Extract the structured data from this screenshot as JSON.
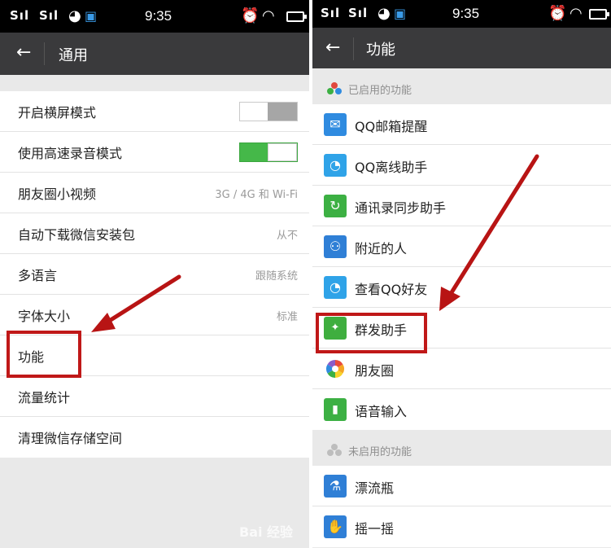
{
  "left": {
    "status": {
      "signal1": "Sıl",
      "signal2": "Sıl",
      "time": "9:35"
    },
    "title": "通用",
    "rows": [
      {
        "label": "开启横屏模式",
        "type": "toggle",
        "state": "off"
      },
      {
        "label": "使用高速录音模式",
        "type": "toggle",
        "state": "on"
      },
      {
        "label": "朋友圈小视频",
        "type": "value",
        "value": "3G / 4G 和 Wi-Fi"
      },
      {
        "label": "自动下载微信安装包",
        "type": "value",
        "value": "从不"
      },
      {
        "label": "多语言",
        "type": "value",
        "value": "跟随系统"
      },
      {
        "label": "字体大小",
        "type": "value",
        "value": "标准"
      },
      {
        "label": "功能",
        "type": "plain"
      },
      {
        "label": "流量统计",
        "type": "plain"
      },
      {
        "label": "清理微信存储空间",
        "type": "plain"
      }
    ],
    "watermark": "Bai 经验"
  },
  "right": {
    "status": {
      "signal1": "Sıl",
      "signal2": "Sıl",
      "time": "9:35"
    },
    "title": "功能",
    "enabled_header": "已启用的功能",
    "enabled": [
      {
        "label": "QQ邮箱提醒",
        "icon": "mail-icon",
        "color": "#2f8be0",
        "glyph": "✉"
      },
      {
        "label": "QQ离线助手",
        "icon": "qq-penguin-icon",
        "color": "#2fa3e8",
        "glyph": "◔"
      },
      {
        "label": "通讯录同步助手",
        "icon": "contact-sync-icon",
        "color": "#3cb043",
        "glyph": "↻"
      },
      {
        "label": "附近的人",
        "icon": "people-nearby-icon",
        "color": "#2f7fd6",
        "glyph": "⚇"
      },
      {
        "label": "查看QQ好友",
        "icon": "qq-friends-icon",
        "color": "#2fa3e8",
        "glyph": "◔"
      },
      {
        "label": "群发助手",
        "icon": "broadcast-icon",
        "color": "#3fae3f",
        "glyph": "✦"
      },
      {
        "label": "朋友圈",
        "icon": "moments-icon",
        "color": "#ffffff",
        "glyph": ""
      },
      {
        "label": "语音输入",
        "icon": "microphone-icon",
        "color": "#3cb043",
        "glyph": "🎙"
      }
    ],
    "disabled_header": "未启用的功能",
    "disabled": [
      {
        "label": "漂流瓶",
        "icon": "drift-bottle-icon",
        "color": "#2f7fd6",
        "glyph": "⚗"
      },
      {
        "label": "摇一摇",
        "icon": "shake-icon",
        "color": "#2f7fd6",
        "glyph": "✋"
      }
    ],
    "watermark": "Bai 经验"
  },
  "colors": {
    "highlight": "#c01818",
    "toggle_on": "#45b849",
    "titlebar": "#3a3a3c"
  }
}
